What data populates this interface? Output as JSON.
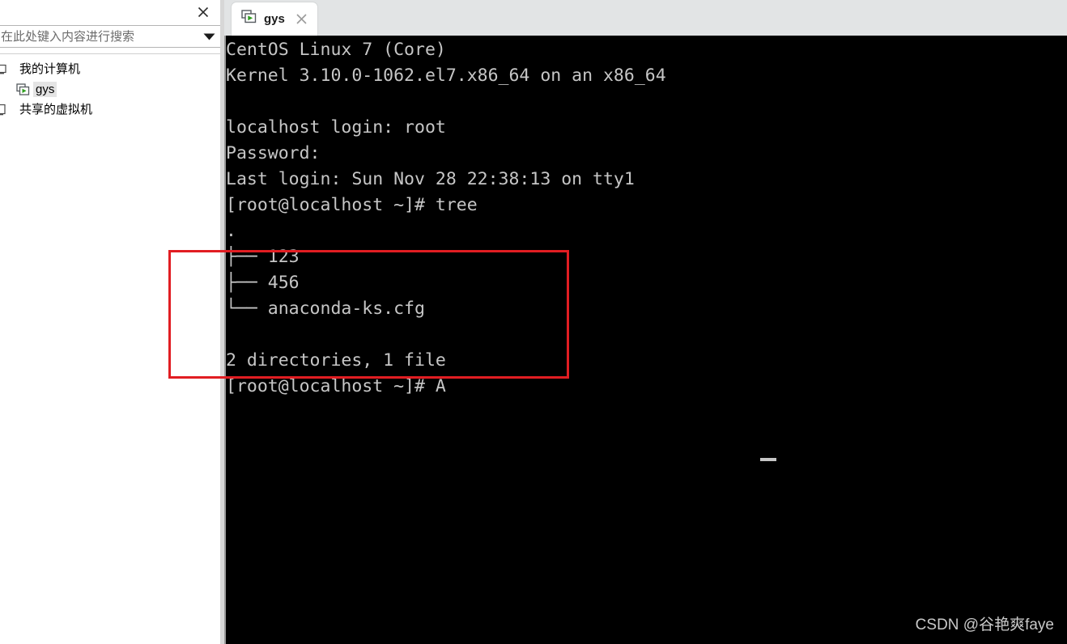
{
  "sidebar": {
    "close_button_label": "×",
    "search": {
      "placeholder": "在此处键入内容进行搜索",
      "value": "",
      "dropdown_icon": "chevron-down-icon"
    },
    "tree_items": [
      {
        "label": "我的计算机",
        "icon": "my-computer-icon",
        "depth": 0,
        "selected": false
      },
      {
        "label": "gys",
        "icon": "virtual-machine-powered-on-icon",
        "depth": 1,
        "selected": true
      },
      {
        "label": "共享的虚拟机",
        "icon": "shared-vms-icon",
        "depth": 0,
        "selected": false
      }
    ]
  },
  "tabbar": {
    "tabs": [
      {
        "label": "gys",
        "icon": "virtual-machine-powered-on-icon",
        "close_icon": "close-icon",
        "active": true
      }
    ]
  },
  "terminal": {
    "colors": {
      "background": "#000000",
      "foreground": "#c6c6c6"
    },
    "lines": [
      "CentOS Linux 7 (Core)",
      "Kernel 3.10.0-1062.el7.x86_64 on an x86_64",
      "",
      "localhost login: root",
      "Password:",
      "Last login: Sun Nov 28 22:38:13 on tty1",
      "[root@localhost ~]# tree",
      ".",
      "├── 123",
      "├── 456",
      "└── anaconda-ks.cfg",
      "",
      "2 directories, 1 file",
      "[root@localhost ~]# A"
    ],
    "text": "CentOS Linux 7 (Core)\nKernel 3.10.0-1062.el7.x86_64 on an x86_64\n\nlocalhost login: root\nPassword:\nLast login: Sun Nov 28 22:38:13 on tty1\n[root@localhost ~]# tree\n.\n├── 123\n├── 456\n└── anaconda-ks.cfg\n\n2 directories, 1 file\n[root@localhost ~]# A"
  },
  "annotation": {
    "highlight_color": "#e11d22",
    "note": "red rectangle around tree output"
  },
  "watermark": {
    "text": "CSDN @谷艳爽faye"
  }
}
